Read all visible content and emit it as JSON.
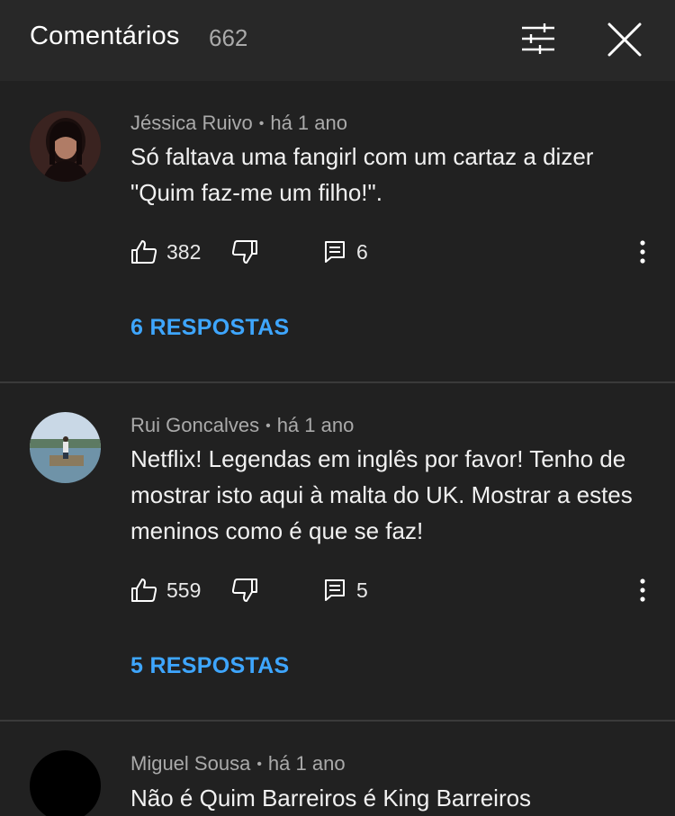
{
  "header": {
    "title": "Comentários",
    "count": "662"
  },
  "comments": [
    {
      "author": "Jéssica Ruivo",
      "time": "há 1 ano",
      "text": "Só faltava uma fangirl com um cartaz a dizer \"Quim faz-me um filho!\".",
      "likes": "382",
      "replies_count": "6",
      "replies_label": "6 RESPOSTAS"
    },
    {
      "author": "Rui Goncalves",
      "time": "há 1 ano",
      "text": "Netflix! Legendas em inglês por favor! Tenho de mostrar isto aqui à malta do UK. Mostrar a estes meninos como é que se faz!",
      "likes": "559",
      "replies_count": "5",
      "replies_label": "5 RESPOSTAS"
    },
    {
      "author": "Miguel Sousa",
      "time": "há 1 ano",
      "text": "Não é Quim Barreiros é King Barreiros"
    }
  ],
  "icons": {
    "filter": "sliders-icon",
    "close": "close-icon",
    "like": "thumbs-up-icon",
    "dislike": "thumbs-down-icon",
    "reply": "comment-icon",
    "more": "more-vert-icon"
  },
  "colors": {
    "background": "#212121",
    "header": "#282828",
    "link": "#3ea6ff",
    "meta": "#aaaaaa"
  }
}
